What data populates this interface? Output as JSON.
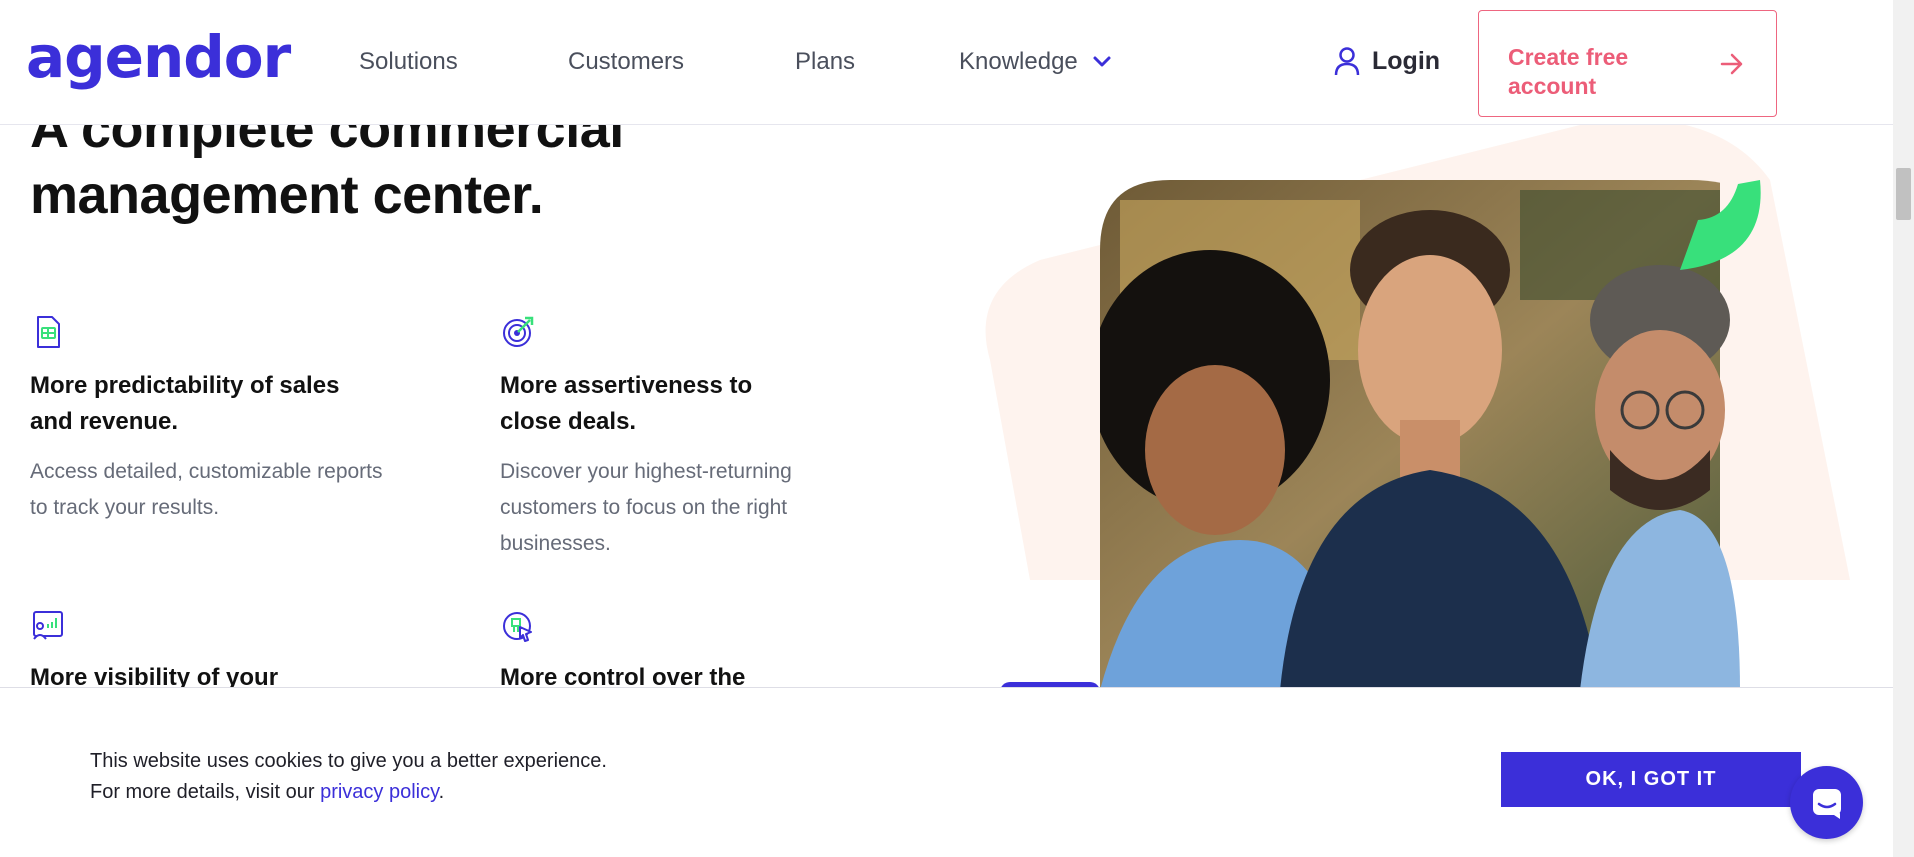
{
  "brand": {
    "logo_text": "agendor",
    "primary_color": "#3b2fd9",
    "accent_color": "#ec5d78",
    "green_accent": "#38e07b"
  },
  "nav": {
    "items": [
      {
        "label": "Solutions"
      },
      {
        "label": "Customers"
      },
      {
        "label": "Plans"
      },
      {
        "label": "Knowledge",
        "icon": "chevron-down-icon"
      }
    ],
    "login_label": "Login",
    "login_icon": "user-icon",
    "cta_label": "Create free account",
    "cta_icon": "arrow-right-icon"
  },
  "hero": {
    "headline_line1": "A complete commercial",
    "headline_line2": "management center."
  },
  "features": [
    {
      "icon": "report-document-icon",
      "title": "More predictability of sales and revenue.",
      "description": "Access detailed, customizable reports to track your results."
    },
    {
      "icon": "target-icon",
      "title": "More assertiveness to close deals.",
      "description": "Discover your highest-returning customers to focus on the right businesses."
    },
    {
      "icon": "dashboard-user-icon",
      "title": "More visibility of your",
      "description": ""
    },
    {
      "icon": "click-control-icon",
      "title": "More control over the",
      "description": ""
    }
  ],
  "cookie": {
    "line1": "This website uses cookies to give you a better experience.",
    "line2_prefix": "For more details, visit our ",
    "link_text": "privacy policy",
    "line2_suffix": ".",
    "button_label": "OK, I GOT IT"
  },
  "chat": {
    "icon": "chat-bubble-icon"
  }
}
